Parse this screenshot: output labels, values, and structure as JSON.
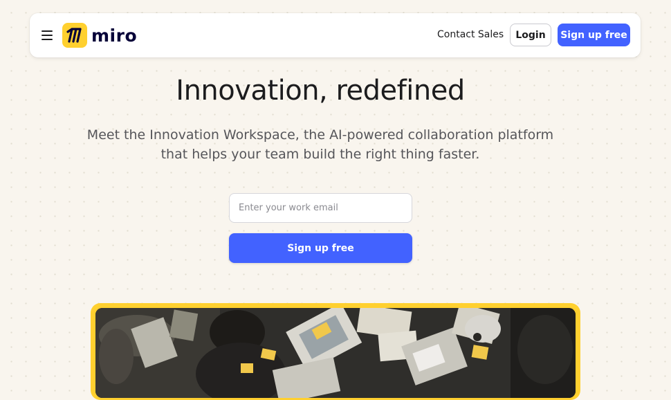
{
  "nav": {
    "logo_text": "miro",
    "contact_sales": "Contact Sales",
    "login": "Login",
    "signup": "Sign up free"
  },
  "hero": {
    "title": "Innovation, redefined",
    "subtitle_line1": "Meet the Innovation Workspace, the AI-powered collaboration platform",
    "subtitle_line2": "that helps your team build the right thing faster.",
    "email_placeholder": "Enter your work email",
    "signup": "Sign up free"
  },
  "colors": {
    "accent": "#4262ff",
    "brand_yellow": "#ffd02f",
    "background": "#f9f5ee"
  },
  "icons": {
    "menu": "hamburger-menu-icon",
    "logo": "miro-logo-icon"
  }
}
